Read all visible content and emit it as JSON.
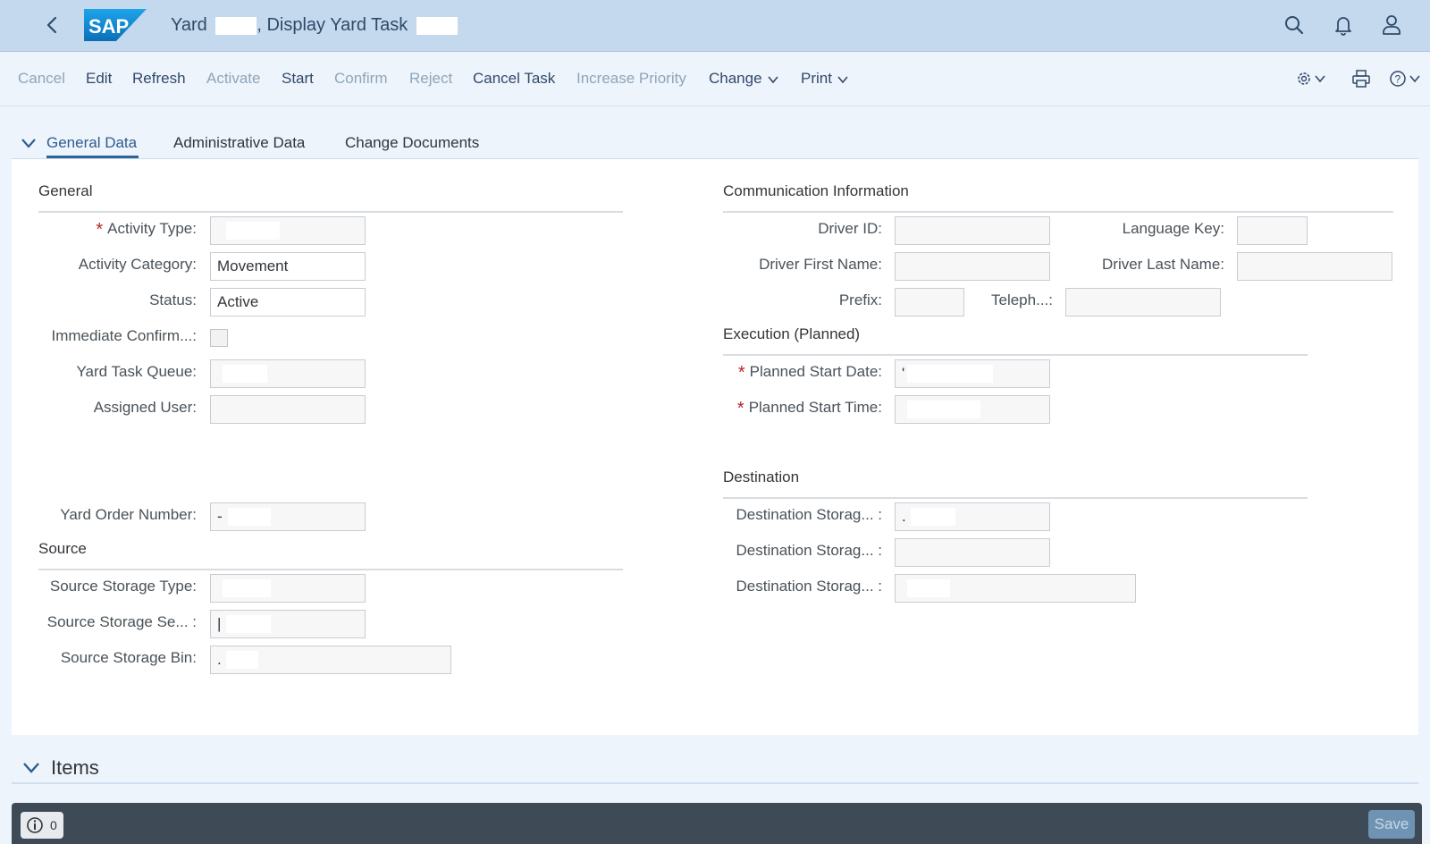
{
  "shell": {
    "title_prefix": "Yard",
    "title_middle": ", Display Yard Task",
    "logo_text": "SAP"
  },
  "toolbar": {
    "cancel": "Cancel",
    "edit": "Edit",
    "refresh": "Refresh",
    "activate": "Activate",
    "start": "Start",
    "confirm": "Confirm",
    "reject": "Reject",
    "cancel_task": "Cancel Task",
    "increase_priority": "Increase Priority",
    "change": "Change",
    "print": "Print"
  },
  "tabs": {
    "general": "General Data",
    "admin": "Administrative Data",
    "changes": "Change Documents"
  },
  "general": {
    "title": "General",
    "activity_type_label": "Activity Type:",
    "activity_category_label": "Activity Category:",
    "activity_category_value": "Movement",
    "status_label": "Status:",
    "status_value": "Active",
    "immediate_confirm_label": "Immediate Confirm...:",
    "yard_task_queue_label": "Yard Task Queue:",
    "assigned_user_label": "Assigned User:",
    "yard_order_number_label": "Yard Order Number:",
    "yard_order_number_value": "-"
  },
  "source": {
    "title": "Source",
    "storage_type_label": "Source Storage Type:",
    "storage_section_label": "Source Storage Se... :",
    "storage_section_value": "|",
    "storage_bin_label": "Source Storage Bin:",
    "storage_bin_value": "."
  },
  "communication": {
    "title": "Communication Information",
    "driver_id_label": "Driver ID:",
    "language_key_label": "Language Key:",
    "driver_first_name_label": "Driver First Name:",
    "driver_last_name_label": "Driver Last Name:",
    "prefix_label": "Prefix:",
    "telephone_label": "Teleph...:"
  },
  "execution": {
    "title": "Execution (Planned)",
    "planned_start_date_label": "Planned Start Date:",
    "planned_start_date_value": "'",
    "planned_start_time_label": "Planned Start Time:"
  },
  "destination": {
    "title": "Destination",
    "storage_1_label": "Destination Storag... :",
    "storage_1_value": ".",
    "storage_2_label": "Destination Storag... :",
    "storage_3_label": "Destination Storag... :"
  },
  "items": {
    "title": "Items"
  },
  "footer": {
    "message_count": "0",
    "save": "Save"
  },
  "colors": {
    "shell_bg": "#c4d9ed",
    "accent": "#2f6497",
    "required": "#bb2424",
    "footer_bg": "#3e4a55"
  }
}
